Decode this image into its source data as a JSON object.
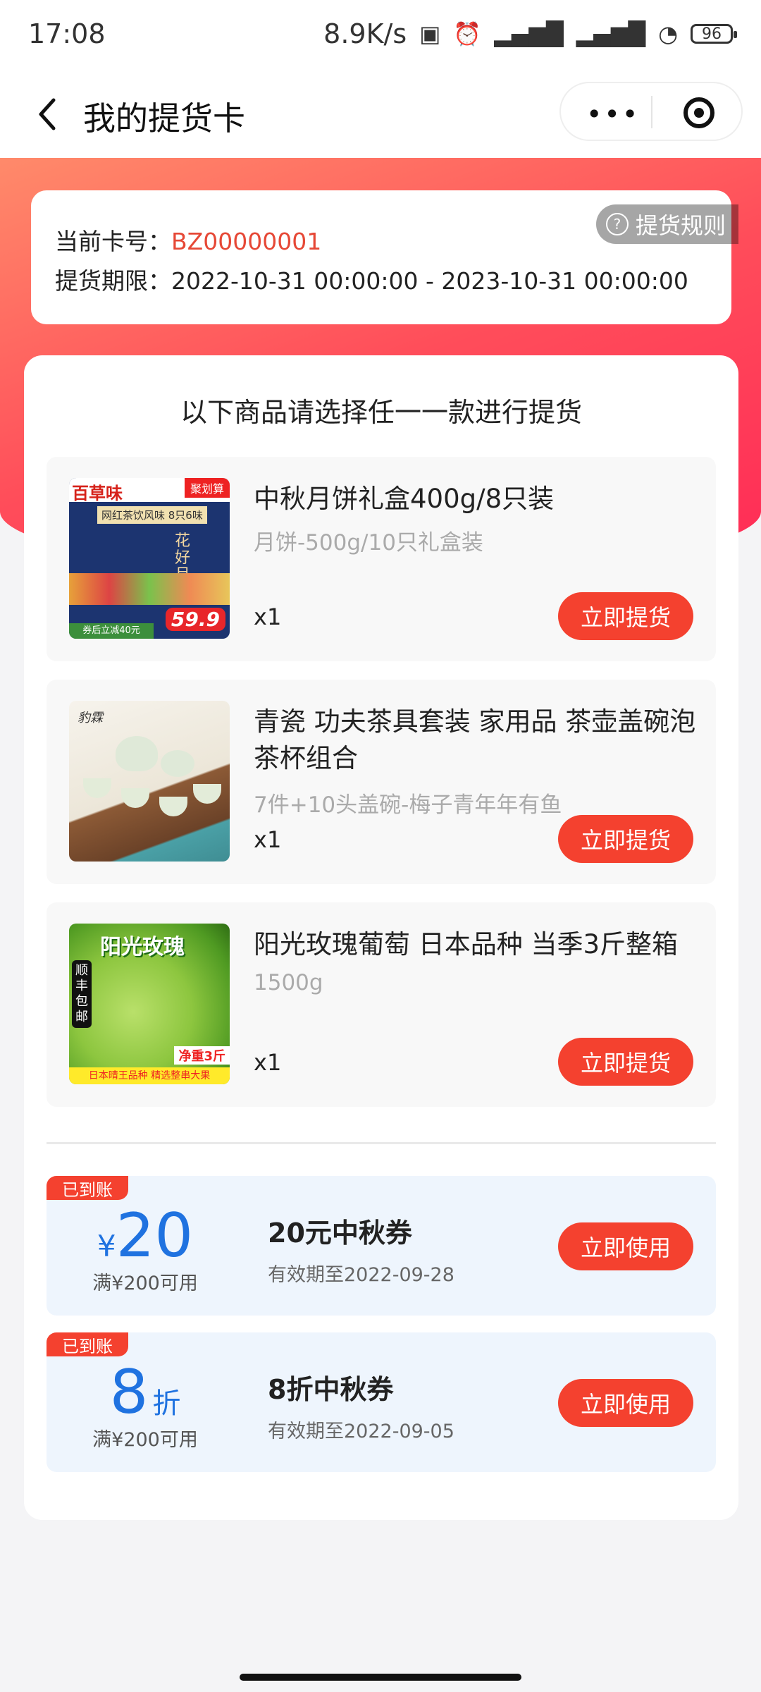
{
  "status_bar": {
    "time": "17:08",
    "speed": "8.9K/s",
    "battery": "96"
  },
  "nav": {
    "title": "我的提货卡"
  },
  "card": {
    "rules_label": "提货规则",
    "number_label": "当前卡号：",
    "number_value": "BZ00000001",
    "period_label": "提货期限：",
    "period_value": "2022-10-31 00:00:00 - 2023-10-31 00:00:00"
  },
  "panel": {
    "title": "以下商品请选择任一一款进行提货"
  },
  "products": [
    {
      "name": "中秋月饼礼盒400g/8只装",
      "spec": "月饼-500g/10只礼盒装",
      "qty": "x1",
      "button": "立即提货",
      "thumb_texts": {
        "brand": "百草味",
        "tag": "聚划算",
        "sub": "网红茶饮风味 8只6味",
        "price": "59.9",
        "coupon": "券后立减40元",
        "art": "花好月圆"
      }
    },
    {
      "name": "青瓷 功夫茶具套装 家用品 茶壶盖碗泡茶杯组合",
      "spec": "7件+10头盖碗-梅子青年年有鱼",
      "qty": "x1",
      "button": "立即提货",
      "thumb_texts": {
        "brand": "豹霖"
      }
    },
    {
      "name": "阳光玫瑰葡萄 日本品种 当季3斤整箱",
      "spec": "1500g",
      "qty": "x1",
      "button": "立即提货",
      "thumb_texts": {
        "title": "阳光玫瑰",
        "sf": "顺丰包邮",
        "weight": "净重3斤",
        "bottom": "日本晴王品种 精选整串大果"
      }
    }
  ],
  "coupons": [
    {
      "tag": "已到账",
      "currency": "¥",
      "amount": "20",
      "unit": "",
      "condition": "满¥200可用",
      "name": "20元中秋券",
      "validity": "有效期至2022-09-28",
      "button": "立即使用"
    },
    {
      "tag": "已到账",
      "currency": "",
      "amount": "8",
      "unit": "折",
      "condition": "满¥200可用",
      "name": "8折中秋券",
      "validity": "有效期至2022-09-05",
      "button": "立即使用"
    }
  ],
  "colors": {
    "accent_red": "#f4412f",
    "coupon_blue": "#1f72e0",
    "card_red_text": "#e64836"
  }
}
